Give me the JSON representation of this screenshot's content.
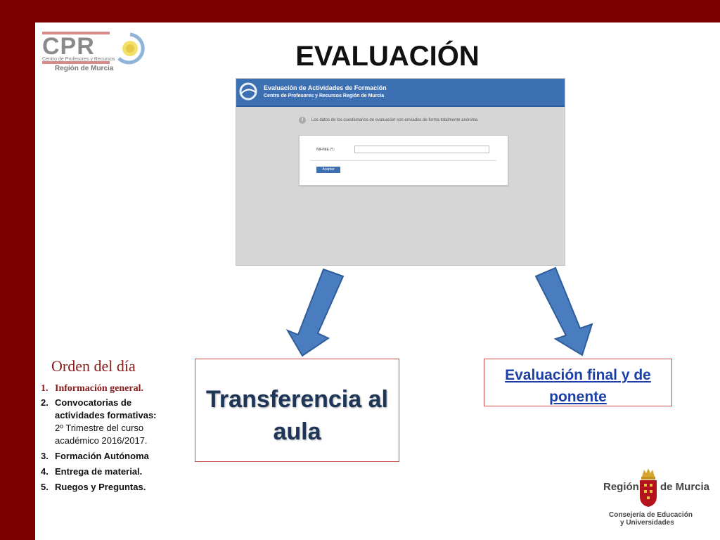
{
  "logo": {
    "letters": "CPR",
    "subtitle": "Centro de Profesores y Recursos",
    "region": "Región de Murcia"
  },
  "title": "EVALUACIÓN",
  "screenshot": {
    "header_title": "Evaluación de Actividades de Formación",
    "header_subtitle": "Centro de Profesores y Recursos Región de Murcia",
    "notice": "Los datos de los cuestionarios de evaluación son enviados de forma totalmente anónima.",
    "field_label": "NIF/NIE (*):",
    "field_value": "",
    "button_label": "Aceptar"
  },
  "agenda": {
    "title": "Orden del día",
    "item1_num": "1.",
    "item1": "Información general.",
    "item2_num": "2.",
    "item2_line1": "Convocatorias de",
    "item2_line2": "actividades formativas:",
    "item2_line3": "2º Trimestre del curso",
    "item2_line4": "académico 2016/2017.",
    "item3_num": "3.",
    "item3": "Formación Autónoma",
    "item4_num": "4.",
    "item4": "Entrega de material.",
    "item5_num": "5.",
    "item5": "Ruegos y Preguntas."
  },
  "box_left": {
    "line1": "Transferencia al",
    "line2": "aula"
  },
  "box_right": {
    "line1": "Evaluación final y de",
    "line2": "ponente"
  },
  "footer_logo": {
    "left": "Región",
    "right": "de Murcia",
    "line1": "Consejería de Educación",
    "line2": "y Universidades"
  },
  "colors": {
    "frame": "#7d0000",
    "arrow_fill": "#4a7cc0",
    "arrow_stroke": "#2f5d99",
    "box_border": "#c94a4a",
    "link_blue": "#1a3fa8",
    "agenda_red": "#8b1a1a"
  }
}
